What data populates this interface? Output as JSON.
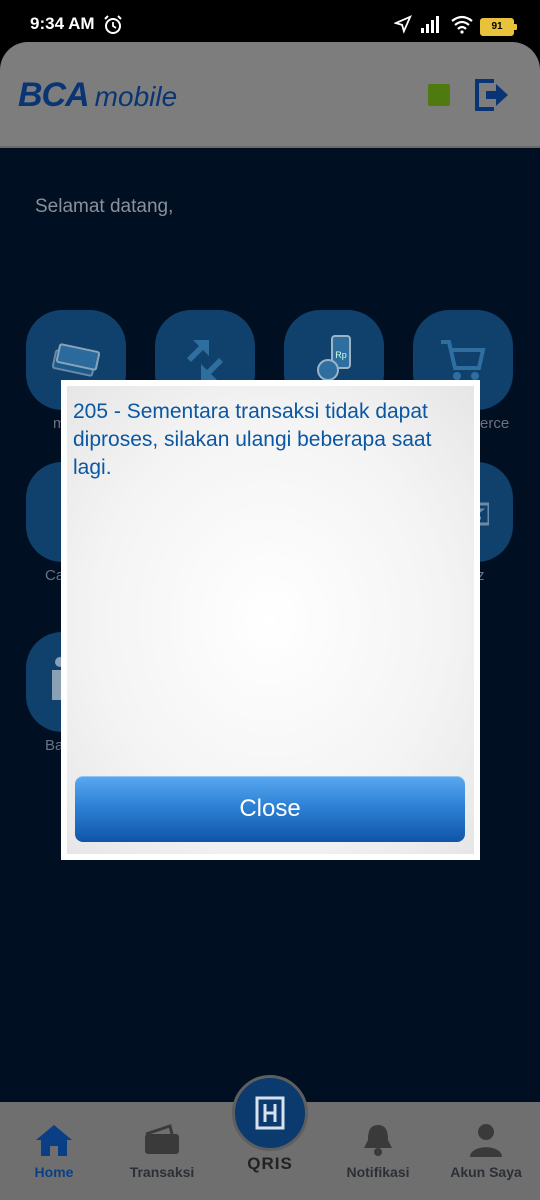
{
  "status_bar": {
    "time": "9:34 AM",
    "battery": "91",
    "icons": [
      "alarm-icon",
      "location-arrow-icon",
      "signal-icon",
      "wifi-icon",
      "battery-icon"
    ]
  },
  "header": {
    "logo_bca": "BCA",
    "logo_mobile": "mobile",
    "status_color": "#4e7a10",
    "logout_icon": "logout-icon"
  },
  "home": {
    "greeting": "Selamat datang,",
    "tiles": [
      {
        "icon": "money-icon",
        "label_fragment": "m"
      },
      {
        "icon": "transfer-arrows-icon",
        "label_fragment": ""
      },
      {
        "icon": "payment-rp-icon",
        "label_fragment": ""
      },
      {
        "icon": "cart-icon",
        "label_fragment": "erce"
      },
      {
        "icon": "cardless-icon",
        "label_fragment": "Ca"
      },
      {
        "icon": "flazz-icon",
        "label_fragment": "z"
      },
      {
        "icon": "bagging-icon",
        "label_fragment": "Ba"
      }
    ]
  },
  "dialog": {
    "message": "205 - Sementara transaksi tidak dapat diproses, silakan ulangi beberapa saat lagi.",
    "close_label": "Close"
  },
  "bottom_nav": {
    "items": [
      {
        "label": "Home",
        "icon": "home-icon",
        "active": true
      },
      {
        "label": "Transaksi",
        "icon": "wallet-icon",
        "active": false
      },
      {
        "label": "Notifikasi",
        "icon": "bell-icon",
        "active": false
      },
      {
        "label": "Akun Saya",
        "icon": "person-icon",
        "active": false
      }
    ],
    "qris_label": "QRIS"
  },
  "colors": {
    "brand_blue": "#0a3574",
    "dialog_text": "#0a57a3",
    "button_blue": "#2e82d6"
  }
}
